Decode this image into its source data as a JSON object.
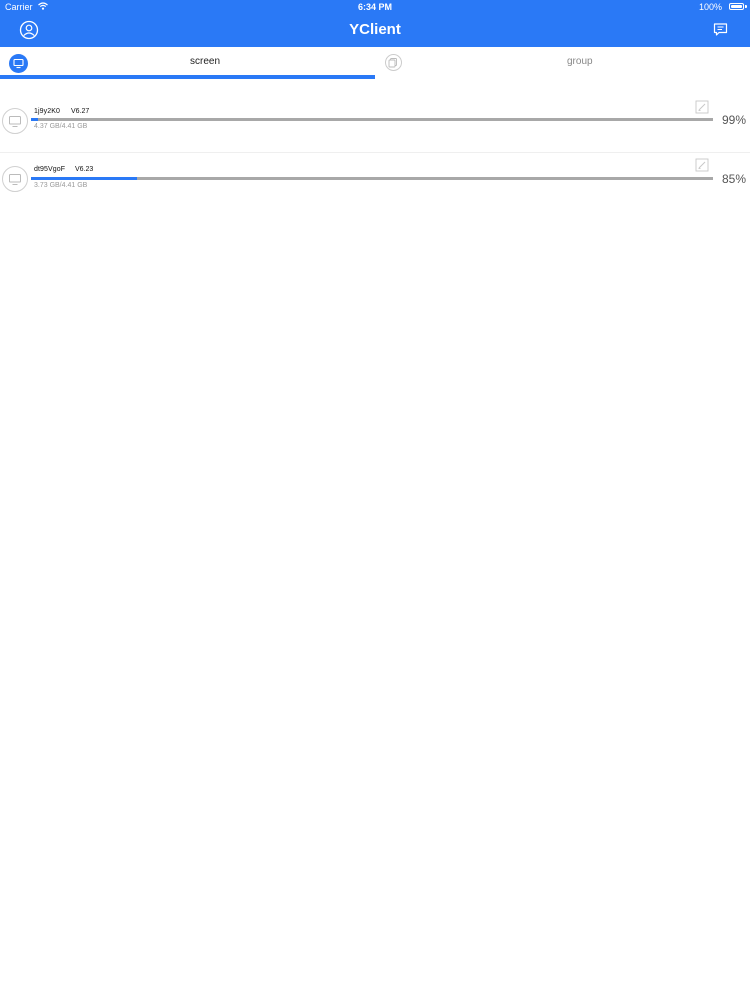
{
  "status_bar": {
    "carrier": "Carrier",
    "time": "6:34 PM",
    "battery": "100%"
  },
  "nav": {
    "title": "YClient",
    "user_icon": "user-circle-icon",
    "message_icon": "message-icon"
  },
  "tabs": [
    {
      "label": "screen",
      "icon": "monitor-icon",
      "active": true
    },
    {
      "label": "group",
      "icon": "copy-icon",
      "active": false
    }
  ],
  "devices": [
    {
      "name": "1j9y2K0",
      "version": "V6.27",
      "storage": "4.37 GB/4.41 GB",
      "percent": "99%",
      "bar_fill": 0.01
    },
    {
      "name": "dt95VgoF",
      "version": "V6.23",
      "storage": "3.73 GB/4.41 GB",
      "percent": "85%",
      "bar_fill": 0.155
    }
  ],
  "colors": {
    "accent": "#2a79f6",
    "track": "#a8a8a8",
    "background": "#ffffff"
  }
}
